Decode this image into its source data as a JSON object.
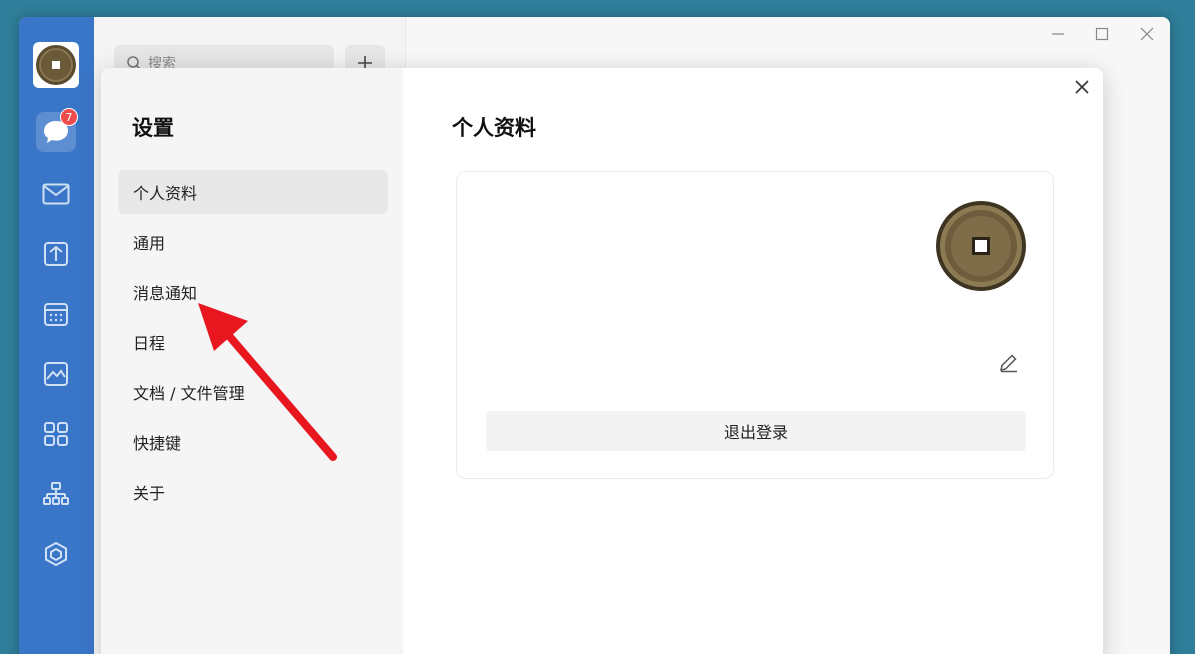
{
  "search": {
    "placeholder": "搜索"
  },
  "sidebar": {
    "badge_count": "7",
    "items": [
      {
        "icon": "chat-icon"
      },
      {
        "icon": "mail-icon"
      },
      {
        "icon": "docs-icon"
      },
      {
        "icon": "calendar-icon"
      },
      {
        "icon": "picture-icon"
      },
      {
        "icon": "apps-icon"
      },
      {
        "icon": "org-chart-icon"
      },
      {
        "icon": "cube-icon"
      }
    ]
  },
  "settings": {
    "title": "设置",
    "items": [
      {
        "label": "个人资料",
        "active": true
      },
      {
        "label": "通用"
      },
      {
        "label": "消息通知"
      },
      {
        "label": "日程"
      },
      {
        "label": "文档 / 文件管理"
      },
      {
        "label": "快捷键"
      },
      {
        "label": "关于"
      }
    ]
  },
  "profile": {
    "title": "个人资料",
    "logout_label": "退出登录"
  },
  "colors": {
    "sidebar": "#3a76c8",
    "background": "#2f7e9a",
    "badge": "#f04b4b",
    "arrow": "#e8171f"
  }
}
